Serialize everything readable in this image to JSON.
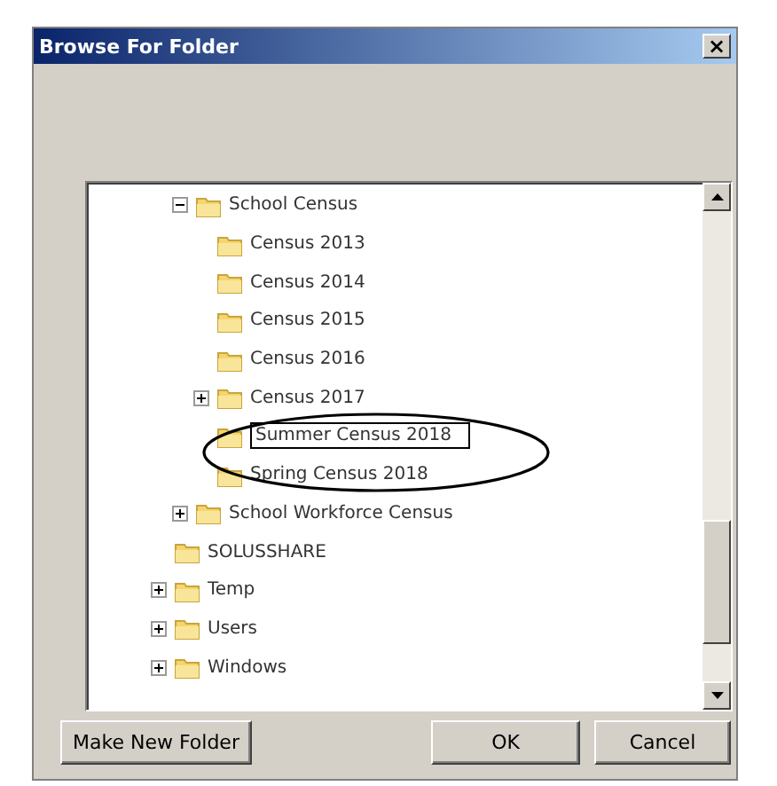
{
  "window": {
    "title": "Browse For Folder",
    "close": "×"
  },
  "tree": {
    "items": [
      {
        "children": [
          {
            "label": "School Census",
            "expanded": true,
            "children": [
              {
                "label": "Census 2013"
              },
              {
                "label": "Census 2014"
              },
              {
                "label": "Census 2015"
              },
              {
                "label": "Census 2016"
              },
              {
                "label": "Census 2017",
                "expanded": false
              },
              {
                "label": "Summer Census 2018",
                "kind": "rename"
              },
              {
                "label": "Spring Census 2018"
              }
            ]
          },
          {
            "label": "School Workforce Census",
            "expanded": false
          }
        ]
      },
      {
        "label": "SOLUSSHARE"
      },
      {
        "label": "Temp",
        "expanded": false
      },
      {
        "label": "Users",
        "expanded": false
      },
      {
        "label": "Windows",
        "expanded": false
      }
    ]
  },
  "buttons": [
    "Make New Folder",
    "OK",
    "Cancel"
  ]
}
